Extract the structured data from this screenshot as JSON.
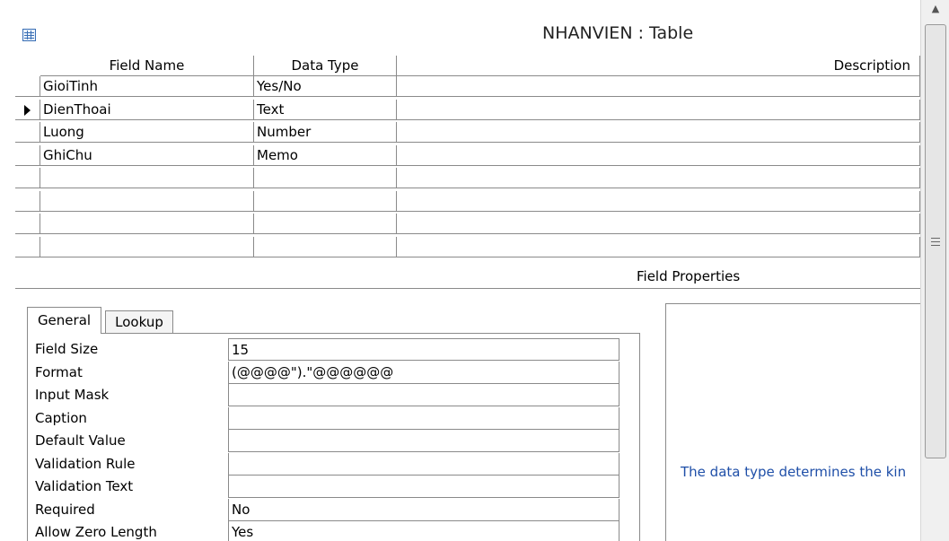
{
  "window": {
    "title": "NHANVIEN : Table"
  },
  "grid": {
    "headers": {
      "field_name": "Field Name",
      "data_type": "Data Type",
      "description": "Description"
    },
    "rows": [
      {
        "field_name": "GioiTinh",
        "data_type": "Yes/No",
        "description": "",
        "current": false
      },
      {
        "field_name": "DienThoai",
        "data_type": "Text",
        "description": "",
        "current": true
      },
      {
        "field_name": "Luong",
        "data_type": "Number",
        "description": "",
        "current": false
      },
      {
        "field_name": "GhiChu",
        "data_type": "Memo",
        "description": "",
        "current": false
      },
      {
        "field_name": "",
        "data_type": "",
        "description": "",
        "current": false
      },
      {
        "field_name": "",
        "data_type": "",
        "description": "",
        "current": false
      },
      {
        "field_name": "",
        "data_type": "",
        "description": "",
        "current": false
      },
      {
        "field_name": "",
        "data_type": "",
        "description": "",
        "current": false
      }
    ]
  },
  "field_properties": {
    "label": "Field Properties",
    "tabs": {
      "general": "General",
      "lookup": "Lookup",
      "active": "general"
    },
    "properties": [
      {
        "label": "Field Size",
        "value": "15"
      },
      {
        "label": "Format",
        "value": "(@@@@\").\"@@@@@@"
      },
      {
        "label": "Input Mask",
        "value": ""
      },
      {
        "label": "Caption",
        "value": ""
      },
      {
        "label": "Default Value",
        "value": ""
      },
      {
        "label": "Validation Rule",
        "value": ""
      },
      {
        "label": "Validation Text",
        "value": ""
      },
      {
        "label": "Required",
        "value": "No"
      },
      {
        "label": "Allow Zero Length",
        "value": "Yes"
      }
    ],
    "help_text": "The data type determines the kin"
  },
  "colors": {
    "help_text": "#1f4fa8",
    "grid_line": "#8a8a8a"
  },
  "icons": {
    "table": "table-icon",
    "row_selector": "current-row-arrow-icon",
    "scroll_up": "scroll-up-arrow-icon"
  }
}
